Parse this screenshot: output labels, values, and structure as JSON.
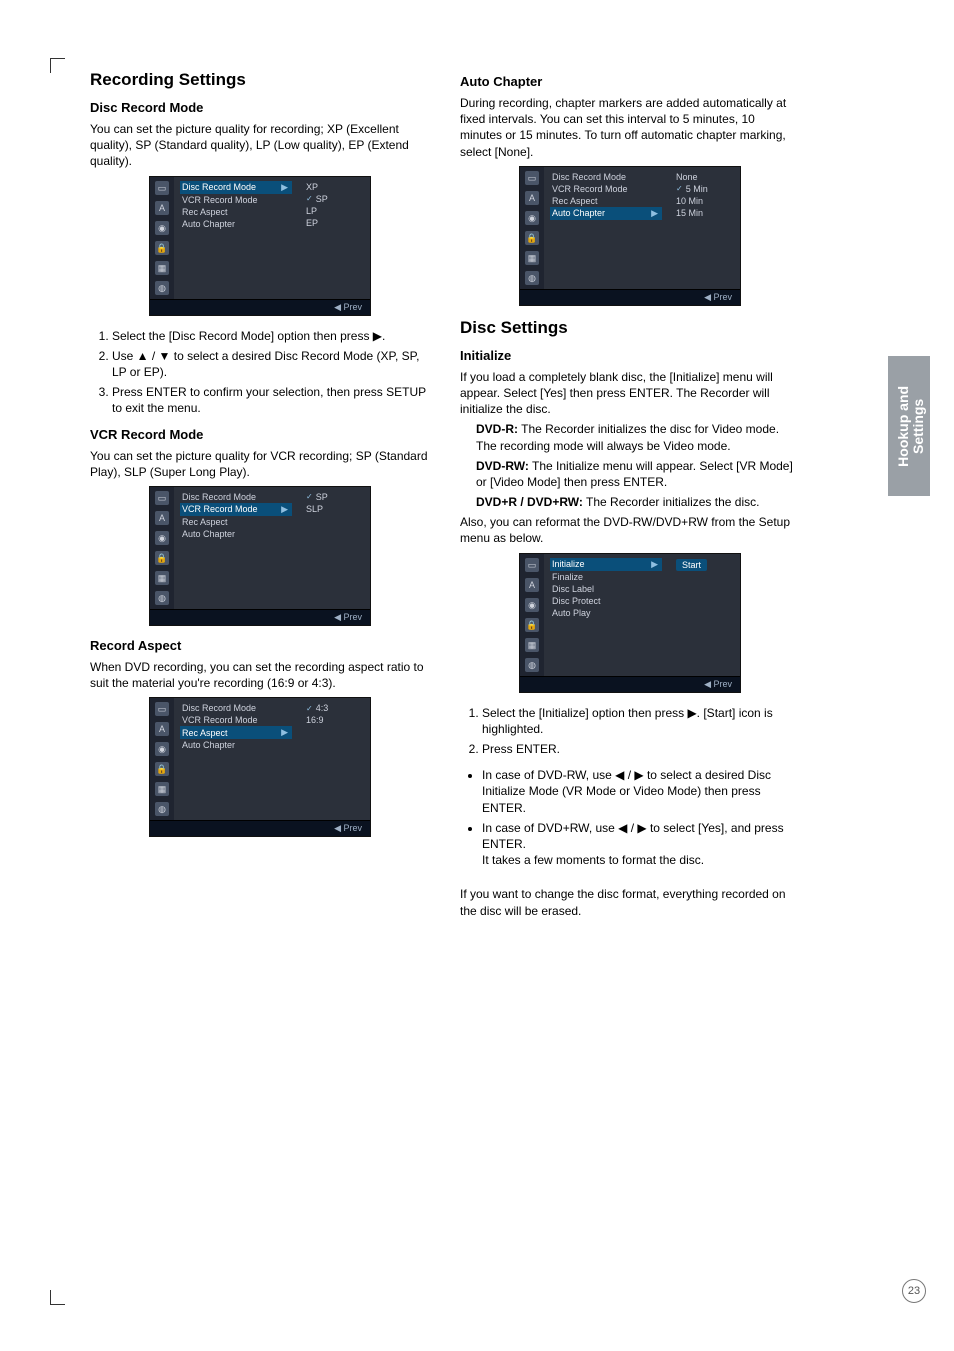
{
  "sidebar": {
    "line1": "Hookup and",
    "line2": "Settings"
  },
  "page_number": "23",
  "left": {
    "h_recset": "Recording Settings",
    "h_drm": "Disc Record Mode",
    "drm_intro": "You can set the picture quality for recording; XP (Excellent quality), SP (Standard quality), LP (Low quality), EP (Extend quality).",
    "drm_steps": {
      "s1": "Select the [Disc Record Mode] option then press ▶.",
      "s2": "Use ▲ / ▼ to select a desired Disc Record Mode (XP, SP, LP or EP).",
      "s3": "Press ENTER to confirm your selection, then press SETUP to exit the menu."
    },
    "h_vrm": "VCR Record Mode",
    "vrm_intro": "You can set the picture quality for VCR recording; SP (Standard Play), SLP (Super Long Play).",
    "h_recasp": "Record Aspect",
    "recasp_intro": "When DVD recording, you can set the recording aspect ratio to suit the material you're recording (16:9 or 4:3)."
  },
  "right": {
    "h_autoch": "Auto Chapter",
    "autoch_intro": "During recording, chapter markers are added automatically at fixed intervals. You can set this interval to 5 minutes, 10 minutes or 15 minutes. To turn off automatic chapter marking, select [None].",
    "h_discset": "Disc Settings",
    "h_init": "Initialize",
    "init_p1": "If you load a completely blank disc, the [Initialize] menu will appear. Select [Yes] then press ENTER. The Recorder will initialize the disc.",
    "init_dvdr_label": "DVD-R:",
    "init_dvdr": " The Recorder initializes the disc for Video mode. The recording mode will always be Video mode.",
    "init_dvdrw_label": "DVD-RW:",
    "init_dvdrw": " The Initialize menu will appear. Select [VR Mode] or [Video Mode] then press ENTER.",
    "init_dvdprw_label": "DVD+R / DVD+RW:",
    "init_dvdprw": " The Recorder initializes the disc.",
    "init_p2": "Also, you can reformat the DVD-RW/DVD+RW from the Setup menu as below.",
    "init_steps": {
      "s1": "Select the [Initialize] option then press ▶. [Start] icon is highlighted.",
      "s2": "Press ENTER."
    },
    "init_bullets": {
      "b1": "In case of DVD-RW, use ◀ / ▶ to select a desired Disc Initialize Mode (VR Mode or Video Mode) then press ENTER.",
      "b2": "In case of DVD+RW, use ◀ / ▶ to select [Yes], and press ENTER.",
      "b2b": "It takes a few moments to format the disc."
    },
    "init_note": "If you want to change the disc format, everything recorded on the disc will be erased."
  },
  "osd_labels": {
    "disc_rec_mode": "Disc Record Mode",
    "vcr_rec_mode": "VCR Record Mode",
    "rec_aspect": "Rec Aspect",
    "auto_chapter": "Auto Chapter",
    "initialize": "Initialize",
    "finalize": "Finalize",
    "disc_label": "Disc Label",
    "disc_protect": "Disc Protect",
    "auto_play": "Auto Play",
    "prev": "◀ Prev",
    "start": "Start",
    "xp": "XP",
    "sp": "SP",
    "lp": "LP",
    "ep": "EP",
    "slp": "SLP",
    "r43": "4:3",
    "r169": "16:9",
    "none": "None",
    "m5": "5 Min",
    "m10": "10 Min",
    "m15": "15 Min"
  }
}
